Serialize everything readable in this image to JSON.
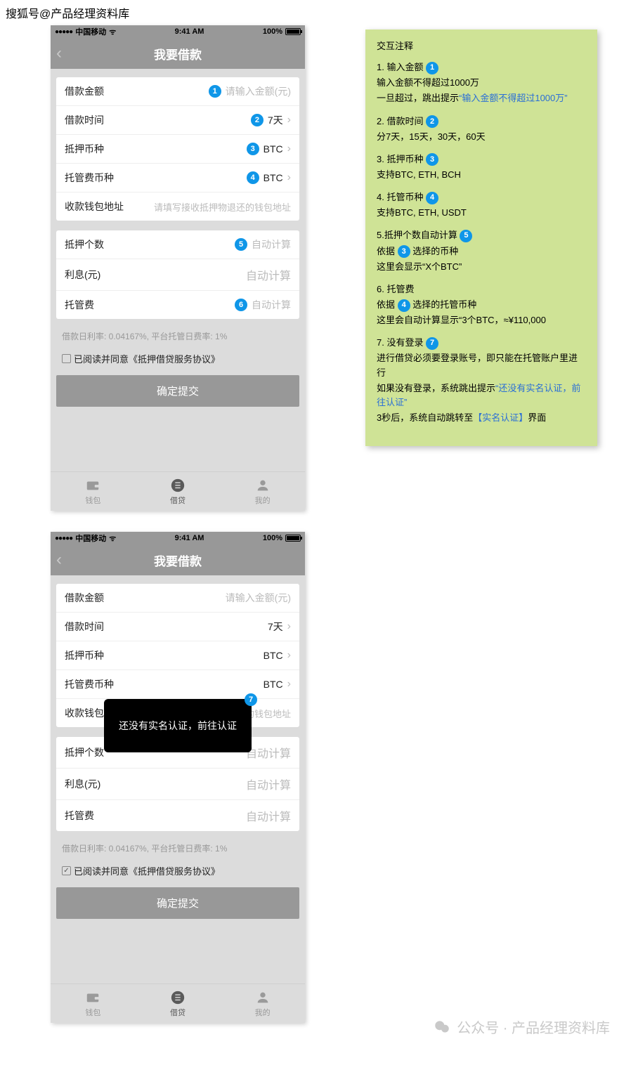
{
  "header": "搜狐号@产品经理资料库",
  "status": {
    "carrier": "中国移动",
    "time": "9:41 AM",
    "battery": "100%"
  },
  "nav": {
    "title": "我要借款"
  },
  "form": {
    "amount_label": "借款金额",
    "amount_placeholder": "请输入金额(元)",
    "time_label": "借款时间",
    "time_value": "7天",
    "coin_label": "抵押币种",
    "coin_value": "BTC",
    "fee_coin_label": "托管费币种",
    "fee_coin_value": "BTC",
    "wallet_label": "收款钱包地址",
    "wallet_placeholder": "请填写接收抵押物退还的钱包地址",
    "count_label": "抵押个数",
    "interest_label": "利息(元)",
    "fee_label": "托管费",
    "auto_text": "自动计算",
    "rate_note": "借款日利率: 0.04167%, 平台托管日费率: 1%",
    "agree_text": "已阅读并同意《抵押借贷服务协议》",
    "submit": "确定提交"
  },
  "tabs": {
    "wallet": "钱包",
    "loan": "借贷",
    "me": "我的"
  },
  "toast": "还没有实名认证，前往认证",
  "annot": {
    "title": "交互注释",
    "s1_h": "1. 输入金额",
    "s1_l1": "输入金额不得超过1000万",
    "s1_l2a": "一旦超过，跳出提示",
    "s1_l2b": "“输入金额不得超过1000万”",
    "s2_h": "2. 借款时间",
    "s2_l1": "分7天，15天，30天，60天",
    "s3_h": "3. 抵押币种",
    "s3_l1": "支持BTC, ETH, BCH",
    "s4_h": "4. 托管币种",
    "s4_l1": "支持BTC, ETH, USDT",
    "s5_h": "5.抵押个数自动计算",
    "s5_l1a": "依据",
    "s5_l1b": "选择的币种",
    "s5_l2": "这里会显示“X个BTC”",
    "s6_h": "6. 托管费",
    "s6_l1a": "依据",
    "s6_l1b": "选择的托管币种",
    "s6_l2": "这里会自动计算显示“3个BTC，≈¥110,000",
    "s7_h": "7. 没有登录",
    "s7_l1": "进行借贷必须要登录账号，即只能在托管账户里进行",
    "s7_l2a": "如果没有登录，系统跳出提示",
    "s7_l2b": "“还没有实名认证，前往认证”",
    "s7_l3a": "3秒后，系统自动跳转至",
    "s7_l3b": "【实名认证】",
    "s7_l3c": "界面"
  },
  "watermark": "公众号 · 产品经理资料库"
}
